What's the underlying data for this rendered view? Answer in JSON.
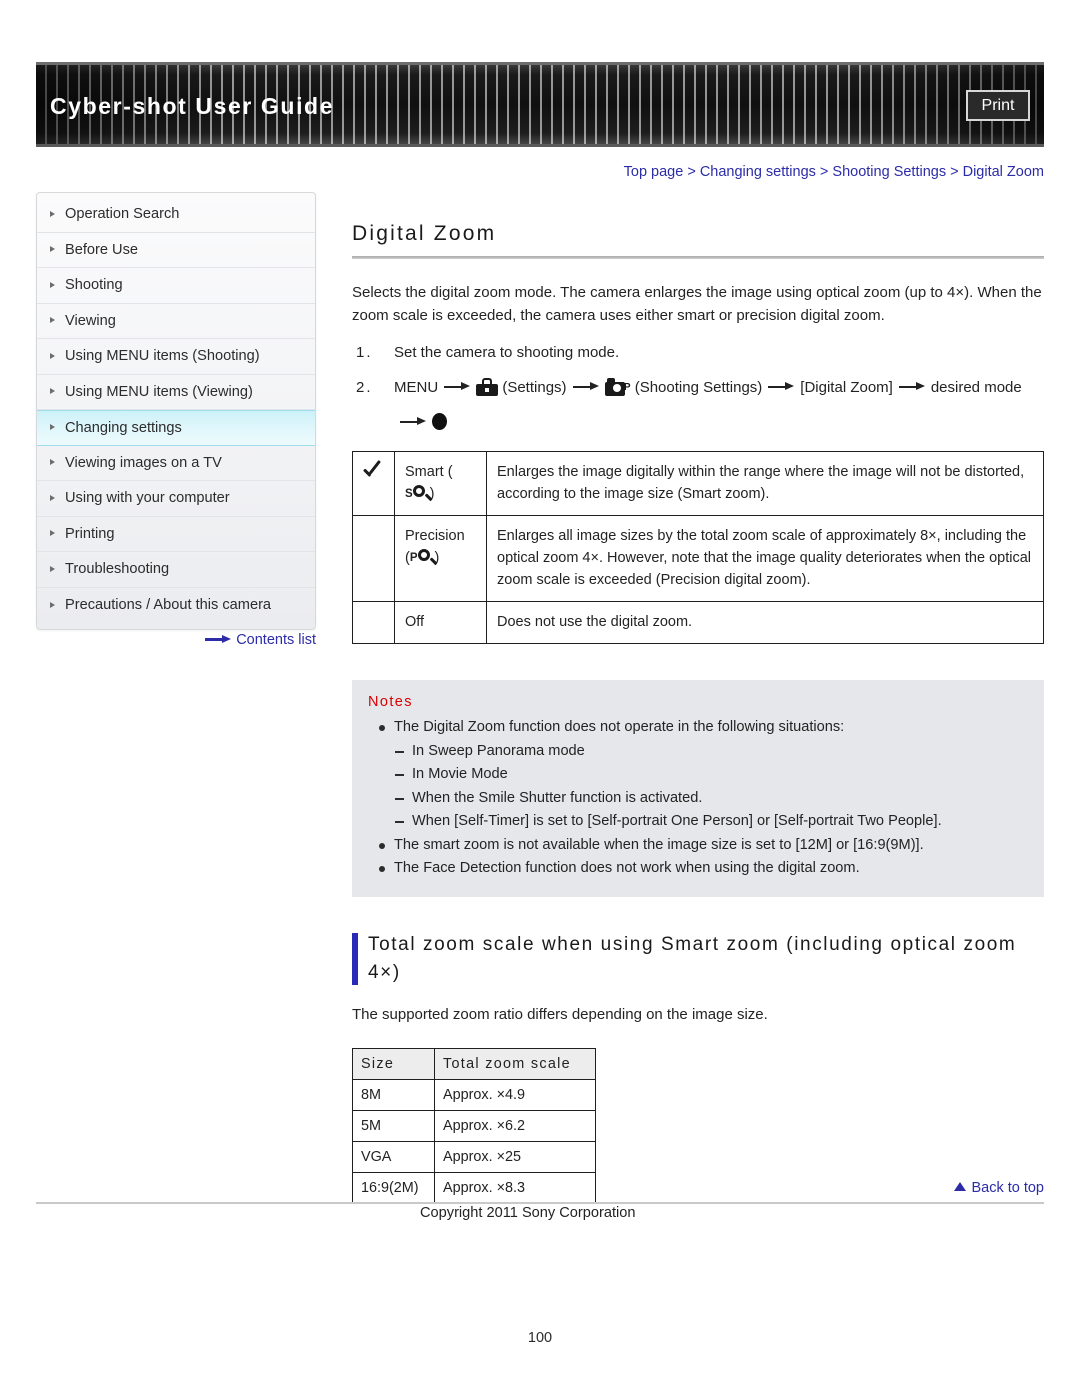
{
  "header": {
    "title": "Cyber-shot User Guide",
    "print_label": "Print"
  },
  "breadcrumb": {
    "text": "Top page > Changing settings > Shooting Settings > Digital Zoom"
  },
  "sidebar": {
    "items": [
      {
        "label": "Operation Search",
        "active": false
      },
      {
        "label": "Before Use",
        "active": false
      },
      {
        "label": "Shooting",
        "active": false
      },
      {
        "label": "Viewing",
        "active": false
      },
      {
        "label": "Using MENU items (Shooting)",
        "active": false
      },
      {
        "label": "Using MENU items (Viewing)",
        "active": false
      },
      {
        "label": "Changing settings",
        "active": true
      },
      {
        "label": "Viewing images on a TV",
        "active": false
      },
      {
        "label": "Using with your computer",
        "active": false
      },
      {
        "label": "Printing",
        "active": false
      },
      {
        "label": "Troubleshooting",
        "active": false
      },
      {
        "label": "Precautions / About this camera",
        "active": false
      }
    ],
    "contents_link": "Contents list"
  },
  "main": {
    "page_title": "Digital Zoom",
    "intro": "Selects the digital zoom mode. The camera enlarges the image using optical zoom (up to 4×). When the zoom scale is exceeded, the camera uses either smart or precision digital zoom.",
    "steps": [
      {
        "num": "1.",
        "text": "Set the camera to shooting mode."
      }
    ],
    "step2": {
      "num": "2.",
      "menu": "MENU",
      "settings_label": "(Settings)",
      "shooting_settings_label": "(Shooting Settings)",
      "item_label": "[Digital Zoom]",
      "desired_label": "desired mode"
    },
    "mode_table": {
      "rows": [
        {
          "checked": true,
          "name": "Smart (",
          "icon_sup": "S",
          "name_close": ")",
          "description": "Enlarges the image digitally within the range where the image will not be distorted, according to the image size (Smart zoom)."
        },
        {
          "checked": false,
          "name": "Precision",
          "icon_open": "(",
          "icon_sup": "P",
          "name_close": ")",
          "description": "Enlarges all image sizes by the total zoom scale of approximately 8×, including the optical zoom 4×. However, note that the image quality deteriorates when the optical zoom scale is exceeded (Precision digital zoom)."
        },
        {
          "checked": false,
          "name": "Off",
          "description": "Does not use the digital zoom."
        }
      ]
    },
    "notes": {
      "title": "Notes",
      "items": [
        {
          "level": 1,
          "text": "The Digital Zoom function does not operate in the following situations:"
        },
        {
          "level": 2,
          "text": "In Sweep Panorama mode"
        },
        {
          "level": 2,
          "text": "In Movie Mode"
        },
        {
          "level": 2,
          "text": "When the Smile Shutter function is activated."
        },
        {
          "level": 2,
          "text": "When [Self-Timer] is set to [Self-portrait One Person] or [Self-portrait Two People]."
        },
        {
          "level": 1,
          "text": "The smart zoom is not available when the image size is set to [12M] or [16:9(9M)]."
        },
        {
          "level": 1,
          "text": "The Face Detection function does not work when using the digital zoom."
        }
      ]
    },
    "section": {
      "heading": "Total zoom scale when using Smart zoom (including optical zoom 4×)",
      "paragraph": "The supported zoom ratio differs depending on the image size."
    },
    "size_table": {
      "headers": [
        "Size",
        "Total zoom scale"
      ],
      "rows": [
        [
          "8M",
          "Approx. ×4.9"
        ],
        [
          "5M",
          "Approx. ×6.2"
        ],
        [
          "VGA",
          "Approx. ×25"
        ],
        [
          "16:9(2M)",
          "Approx. ×8.3"
        ]
      ]
    }
  },
  "footer": {
    "back_to_top": "Back to top",
    "copyright": "Copyright 2011 Sony Corporation",
    "page_number": "100"
  },
  "colors": {
    "link": "#2c2ca8",
    "notes_title": "#d90000",
    "accent_bar": "#2a2ab4",
    "sidebar_active": "#ccf1f8"
  }
}
